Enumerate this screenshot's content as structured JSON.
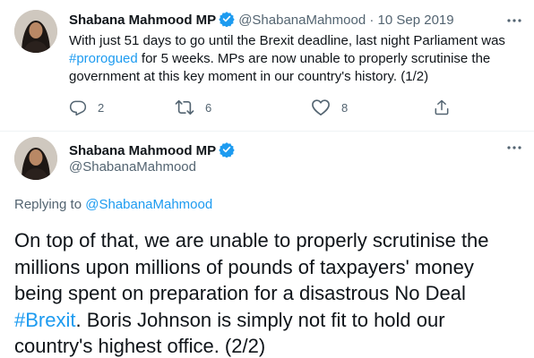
{
  "tweet1": {
    "author_name": "Shabana Mahmood MP",
    "handle": "@ShabanaMahmood",
    "separator": " · ",
    "date": "10 Sep 2019",
    "text_before_hashtag": "With just 51 days to go until the Brexit deadline, last night Parliament was ",
    "hashtag": "#prorogued",
    "text_after_hashtag": " for 5 weeks. MPs are now unable to properly scrutinise the government at this key moment in our country's history. (1/2)",
    "reply_count": "2",
    "retweet_count": "6",
    "like_count": "8"
  },
  "tweet2": {
    "author_name": "Shabana Mahmood MP",
    "handle": "@ShabanaMahmood",
    "replying_label": "Replying to ",
    "replying_handle": "@ShabanaMahmood",
    "text_before_hashtag": "On top of that, we are unable to properly scrutinise the millions upon millions of pounds of taxpayers' money being spent on preparation for a disastrous No Deal ",
    "hashtag": "#Brexit",
    "text_after_hashtag": ". Boris Johnson is simply not fit to hold our country's highest office. (2/2)"
  },
  "colors": {
    "accent": "#1d9bf0",
    "text": "#0f1419",
    "muted": "#536471",
    "divider": "#eff3f4"
  },
  "icons": {
    "verified": "verified-badge-icon",
    "more": "more-icon",
    "reply": "reply-icon",
    "retweet": "retweet-icon",
    "like": "like-icon",
    "share": "share-icon"
  }
}
